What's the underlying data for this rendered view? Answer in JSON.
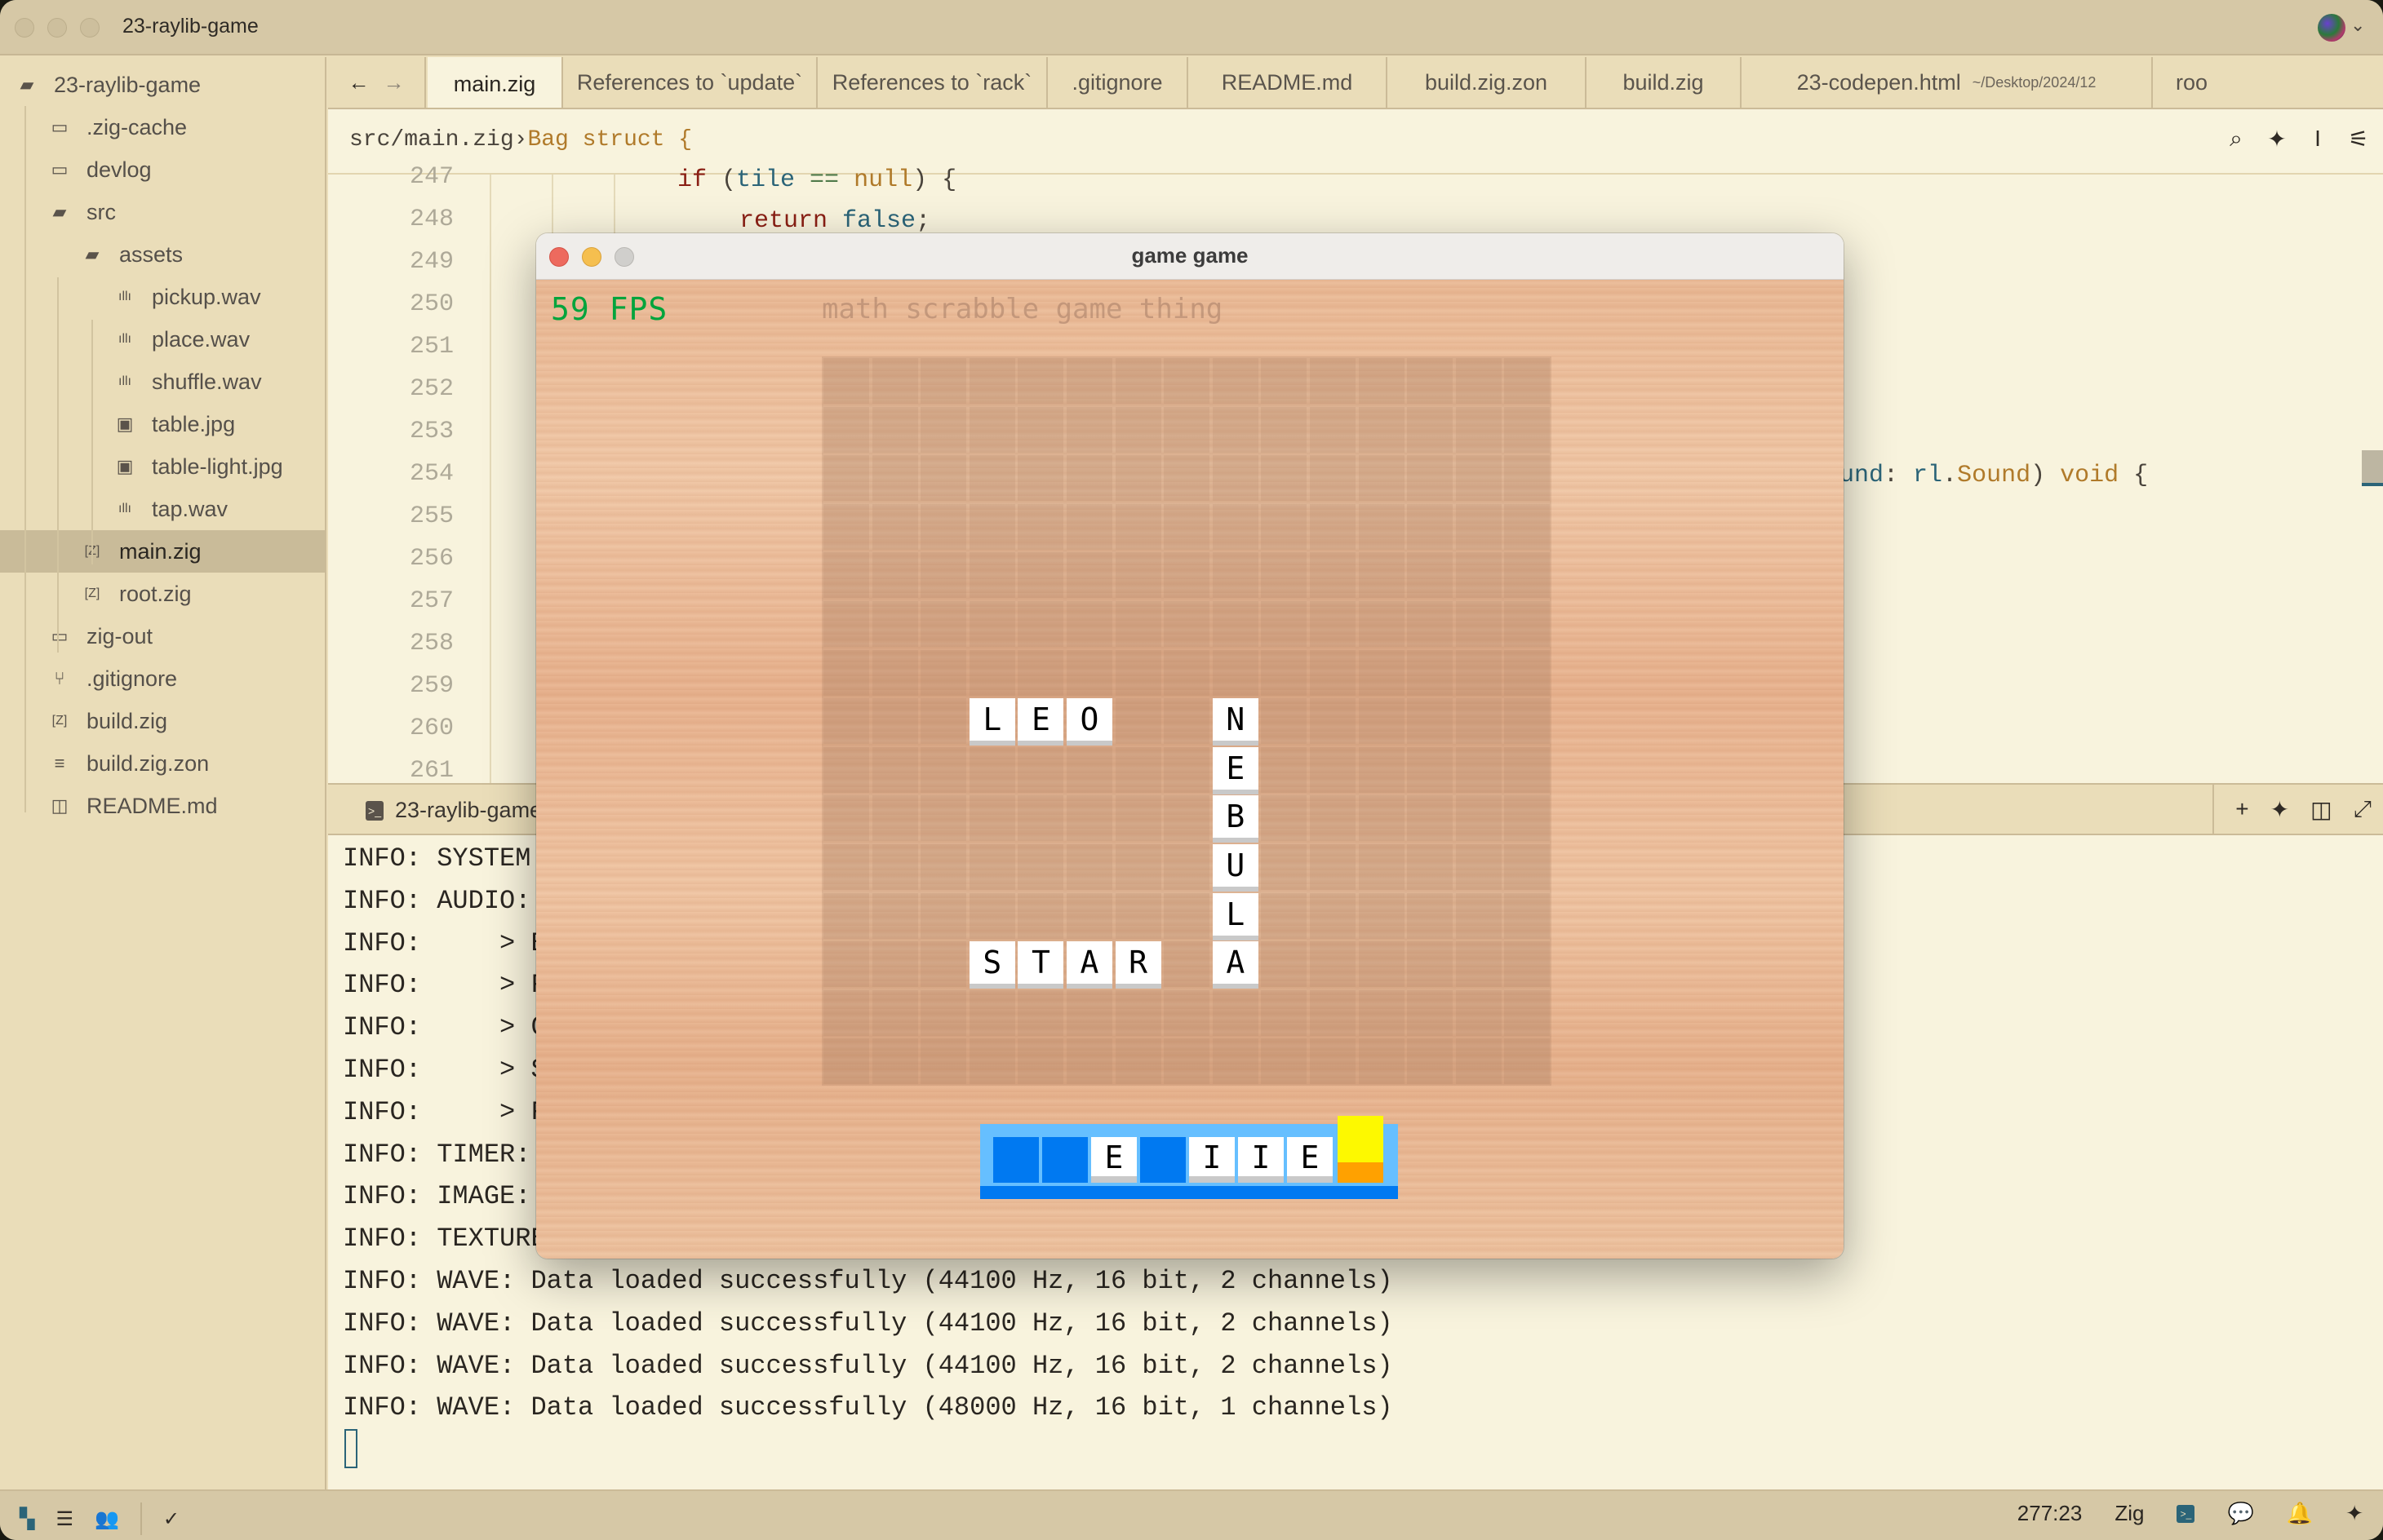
{
  "window": {
    "title": "23-raylib-game"
  },
  "sidebar": {
    "items": [
      {
        "label": "23-raylib-game",
        "icon": "folder-open-icon",
        "depth": 0
      },
      {
        "label": ".zig-cache",
        "icon": "folder-icon",
        "depth": 1
      },
      {
        "label": "devlog",
        "icon": "folder-icon",
        "depth": 1
      },
      {
        "label": "src",
        "icon": "folder-open-icon",
        "depth": 1
      },
      {
        "label": "assets",
        "icon": "folder-open-icon",
        "depth": 2
      },
      {
        "label": "pickup.wav",
        "icon": "audio-file-icon",
        "depth": 3
      },
      {
        "label": "place.wav",
        "icon": "audio-file-icon",
        "depth": 3
      },
      {
        "label": "shuffle.wav",
        "icon": "audio-file-icon",
        "depth": 3
      },
      {
        "label": "table.jpg",
        "icon": "image-file-icon",
        "depth": 3
      },
      {
        "label": "table-light.jpg",
        "icon": "image-file-icon",
        "depth": 3
      },
      {
        "label": "tap.wav",
        "icon": "audio-file-icon",
        "depth": 3
      },
      {
        "label": "main.zig",
        "icon": "zig-file-icon",
        "depth": 2,
        "selected": true
      },
      {
        "label": "root.zig",
        "icon": "zig-file-icon",
        "depth": 2
      },
      {
        "label": "zig-out",
        "icon": "folder-icon",
        "depth": 1
      },
      {
        "label": ".gitignore",
        "icon": "git-icon",
        "depth": 1
      },
      {
        "label": "build.zig",
        "icon": "zig-file-icon",
        "depth": 1
      },
      {
        "label": "build.zig.zon",
        "icon": "text-file-icon",
        "depth": 1
      },
      {
        "label": "README.md",
        "icon": "book-icon",
        "depth": 1
      }
    ]
  },
  "tabs": [
    {
      "label": "main.zig",
      "active": true
    },
    {
      "label": "References to `update`"
    },
    {
      "label": "References to `rack`"
    },
    {
      "label": ".gitignore"
    },
    {
      "label": "README.md"
    },
    {
      "label": "build.zig.zon"
    },
    {
      "label": "build.zig"
    },
    {
      "label": "23-codepen.html",
      "sublabel": "~/Desktop/2024/12"
    },
    {
      "label": "roo"
    }
  ],
  "editor": {
    "breadcrumb_path": "src/main.zig",
    "breadcrumb_sep": "›",
    "breadcrumb_symbol": "Bag struct {",
    "line_numbers": [
      "247",
      "248",
      "249",
      "250",
      "251",
      "252",
      "253",
      "254",
      "255",
      "256",
      "257",
      "258",
      "259",
      "260",
      "261"
    ],
    "code": {
      "line247": {
        "kw": "if",
        "rest_open": " (",
        "id": "tile",
        "op": " == ",
        "ty": "null",
        "close": ") {"
      },
      "line248": {
        "kw": "return",
        "sp": " ",
        "id": "false",
        "end": ";"
      },
      "line254": {
        "id1": "und",
        "p1": ": ",
        "id2": "rl",
        "dot": ".",
        "ty1": "Sound",
        "p2": ") ",
        "ty2": "void",
        "p3": " {"
      }
    }
  },
  "terminal": {
    "tab_label": "23-raylib-game",
    "lines": [
      "INFO: SYSTEM:",
      "INFO: AUDIO:",
      "INFO:     > B",
      "INFO:     > F",
      "INFO:     > C",
      "INFO:     > S",
      "INFO:     > F",
      "INFO: TIMER:",
      "INFO: IMAGE:",
      "INFO: TEXTURE",
      "INFO: WAVE: Data loaded successfully (44100 Hz, 16 bit, 2 channels)",
      "INFO: WAVE: Data loaded successfully (44100 Hz, 16 bit, 2 channels)",
      "INFO: WAVE: Data loaded successfully (44100 Hz, 16 bit, 2 channels)",
      "INFO: WAVE: Data loaded successfully (48000 Hz, 16 bit, 1 channels)"
    ]
  },
  "statusbar": {
    "cursor_position": "277:23",
    "language": "Zig"
  },
  "game": {
    "window_title": "game game",
    "fps_label": "59 FPS",
    "caption": "math scrabble game thing",
    "board_size": 15,
    "placed_tiles": [
      {
        "letter": "L",
        "row": 7,
        "col": 3
      },
      {
        "letter": "E",
        "row": 7,
        "col": 4
      },
      {
        "letter": "O",
        "row": 7,
        "col": 5
      },
      {
        "letter": "N",
        "row": 7,
        "col": 8
      },
      {
        "letter": "E",
        "row": 8,
        "col": 8
      },
      {
        "letter": "B",
        "row": 9,
        "col": 8
      },
      {
        "letter": "U",
        "row": 10,
        "col": 8
      },
      {
        "letter": "L",
        "row": 11,
        "col": 8
      },
      {
        "letter": "S",
        "row": 12,
        "col": 3
      },
      {
        "letter": "T",
        "row": 12,
        "col": 4
      },
      {
        "letter": "A",
        "row": 12,
        "col": 5
      },
      {
        "letter": "R",
        "row": 12,
        "col": 6
      },
      {
        "letter": "A",
        "row": 12,
        "col": 8
      }
    ],
    "rack": [
      "",
      "",
      "E",
      "",
      "I",
      "I",
      "E"
    ],
    "colors": {
      "fps": "#00a43c",
      "rack_bg": "#66bfff",
      "rack_empty_slot": "#0079f1",
      "shuffle_top": "#fdf900",
      "shuffle_bottom": "#ffa100"
    }
  }
}
